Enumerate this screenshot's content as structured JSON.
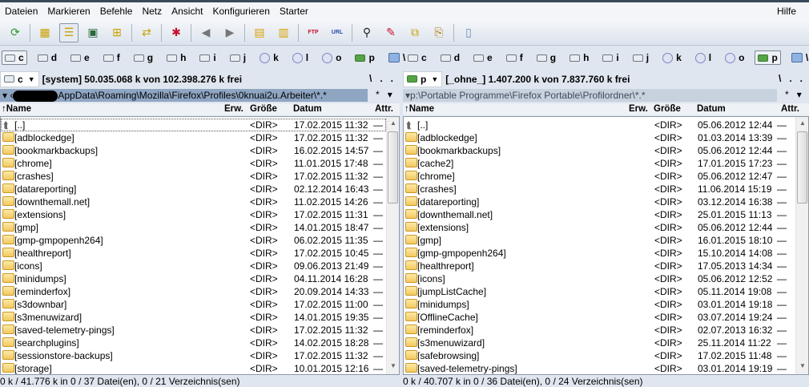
{
  "menu": {
    "items": [
      "Dateien",
      "Markieren",
      "Befehle",
      "Netz",
      "Ansicht",
      "Konfigurieren",
      "Starter"
    ],
    "help": "Hilfe"
  },
  "toolbar": {
    "icons": [
      "refresh-icon",
      "brief-view-icon",
      "full-view-icon",
      "thumbnail-view-icon",
      "tree-view-icon",
      "sync-dirs-icon",
      "select-icon",
      "back-icon",
      "forward-icon",
      "pack-icon",
      "unpack-icon",
      "ftp-icon",
      "url-icon",
      "search-icon",
      "rename-icon",
      "compare-icon",
      "copy-names-icon",
      "notepad-icon"
    ],
    "ftp": "FTP",
    "url": "URL"
  },
  "drives": [
    "c",
    "d",
    "e",
    "f",
    "g",
    "h",
    "i",
    "j",
    "k",
    "l",
    "o",
    "p",
    "\\"
  ],
  "left": {
    "drive": "c",
    "free": "[system]  50.035.068 k von 102.398.276 k frei",
    "root": "\\",
    "parent": "..",
    "path": "AppData\\Roaming\\Mozilla\\Firefox\\Profiles\\0knuai2u.Arbeiter\\*.*",
    "path_prefix": "▾ ‹",
    "star": "*",
    "menu": "▾",
    "headers": {
      "name": "↑Name",
      "ext": "Erw.",
      "size": "Größe",
      "date": "Datum",
      "attr": "Attr."
    },
    "rows": [
      {
        "name": "[..]",
        "size": "<DIR>",
        "date": "17.02.2015 11:32",
        "attr": "—",
        "up": true
      },
      {
        "name": "[adblockedge]",
        "size": "<DIR>",
        "date": "17.02.2015 11:32",
        "attr": "—"
      },
      {
        "name": "[bookmarkbackups]",
        "size": "<DIR>",
        "date": "16.02.2015 14:57",
        "attr": "—"
      },
      {
        "name": "[chrome]",
        "size": "<DIR>",
        "date": "11.01.2015 17:48",
        "attr": "—"
      },
      {
        "name": "[crashes]",
        "size": "<DIR>",
        "date": "17.02.2015 11:32",
        "attr": "—"
      },
      {
        "name": "[datareporting]",
        "size": "<DIR>",
        "date": "02.12.2014 16:43",
        "attr": "—"
      },
      {
        "name": "[downthemall.net]",
        "size": "<DIR>",
        "date": "11.02.2015 14:26",
        "attr": "—"
      },
      {
        "name": "[extensions]",
        "size": "<DIR>",
        "date": "17.02.2015 11:31",
        "attr": "—"
      },
      {
        "name": "[gmp]",
        "size": "<DIR>",
        "date": "14.01.2015 18:47",
        "attr": "—"
      },
      {
        "name": "[gmp-gmpopenh264]",
        "size": "<DIR>",
        "date": "06.02.2015 11:35",
        "attr": "—"
      },
      {
        "name": "[healthreport]",
        "size": "<DIR>",
        "date": "17.02.2015 10:45",
        "attr": "—"
      },
      {
        "name": "[icons]",
        "size": "<DIR>",
        "date": "09.06.2013 21:49",
        "attr": "—"
      },
      {
        "name": "[minidumps]",
        "size": "<DIR>",
        "date": "04.11.2014 16:28",
        "attr": "—"
      },
      {
        "name": "[reminderfox]",
        "size": "<DIR>",
        "date": "20.09.2014 14:33",
        "attr": "—"
      },
      {
        "name": "[s3downbar]",
        "size": "<DIR>",
        "date": "17.02.2015 11:00",
        "attr": "—"
      },
      {
        "name": "[s3menuwizard]",
        "size": "<DIR>",
        "date": "14.01.2015 19:35",
        "attr": "—"
      },
      {
        "name": "[saved-telemetry-pings]",
        "size": "<DIR>",
        "date": "17.02.2015 11:32",
        "attr": "—"
      },
      {
        "name": "[searchplugins]",
        "size": "<DIR>",
        "date": "14.02.2015 18:28",
        "attr": "—"
      },
      {
        "name": "[sessionstore-backups]",
        "size": "<DIR>",
        "date": "17.02.2015 11:32",
        "attr": "—"
      },
      {
        "name": "[storage]",
        "size": "<DIR>",
        "date": "10.01.2015 12:16",
        "attr": "—"
      }
    ],
    "status": "0 k / 41.776 k in 0 / 37 Datei(en), 0 / 21 Verzeichnis(sen)"
  },
  "right": {
    "drive": "p",
    "free": "[_ohne_]  1.407.200 k von 7.837.760 k frei",
    "root": "\\",
    "parent": "..",
    "path": "p:\\Portable Programme\\Firefox Portable\\Profilordner\\*.*",
    "path_prefix": "▾",
    "star": "*",
    "menu": "▾",
    "headers": {
      "name": "↑Name",
      "ext": "Erw.",
      "size": "Größe",
      "date": "Datum",
      "attr": "Attr."
    },
    "rows": [
      {
        "name": "[..]",
        "size": "<DIR>",
        "date": "05.06.2012 12:44",
        "attr": "—",
        "up": true
      },
      {
        "name": "[adblockedge]",
        "size": "<DIR>",
        "date": "01.03.2014 13:39",
        "attr": "—"
      },
      {
        "name": "[bookmarkbackups]",
        "size": "<DIR>",
        "date": "05.06.2012 12:44",
        "attr": "—"
      },
      {
        "name": "[cache2]",
        "size": "<DIR>",
        "date": "17.01.2015 17:23",
        "attr": "—"
      },
      {
        "name": "[chrome]",
        "size": "<DIR>",
        "date": "05.06.2012 12:47",
        "attr": "—"
      },
      {
        "name": "[crashes]",
        "size": "<DIR>",
        "date": "11.06.2014 15:19",
        "attr": "—"
      },
      {
        "name": "[datareporting]",
        "size": "<DIR>",
        "date": "03.12.2014 16:38",
        "attr": "—"
      },
      {
        "name": "[downthemall.net]",
        "size": "<DIR>",
        "date": "25.01.2015 11:13",
        "attr": "—"
      },
      {
        "name": "[extensions]",
        "size": "<DIR>",
        "date": "05.06.2012 12:44",
        "attr": "—"
      },
      {
        "name": "[gmp]",
        "size": "<DIR>",
        "date": "16.01.2015 18:10",
        "attr": "—"
      },
      {
        "name": "[gmp-gmpopenh264]",
        "size": "<DIR>",
        "date": "15.10.2014 14:08",
        "attr": "—"
      },
      {
        "name": "[healthreport]",
        "size": "<DIR>",
        "date": "17.05.2013 14:34",
        "attr": "—"
      },
      {
        "name": "[icons]",
        "size": "<DIR>",
        "date": "05.06.2012 12:52",
        "attr": "—"
      },
      {
        "name": "[jumpListCache]",
        "size": "<DIR>",
        "date": "05.11.2014 19:08",
        "attr": "—"
      },
      {
        "name": "[minidumps]",
        "size": "<DIR>",
        "date": "03.01.2014 19:18",
        "attr": "—"
      },
      {
        "name": "[OfflineCache]",
        "size": "<DIR>",
        "date": "03.07.2014 19:24",
        "attr": "—"
      },
      {
        "name": "[reminderfox]",
        "size": "<DIR>",
        "date": "02.07.2013 16:32",
        "attr": "—"
      },
      {
        "name": "[s3menuwizard]",
        "size": "<DIR>",
        "date": "25.11.2014 11:22",
        "attr": "—"
      },
      {
        "name": "[safebrowsing]",
        "size": "<DIR>",
        "date": "17.02.2015 11:48",
        "attr": "—"
      },
      {
        "name": "[saved-telemetry-pings]",
        "size": "<DIR>",
        "date": "03.01.2014 19:19",
        "attr": "—"
      }
    ],
    "status": "0 k / 40.707 k in 0 / 36 Datei(en), 0 / 24 Verzeichnis(sen)"
  }
}
